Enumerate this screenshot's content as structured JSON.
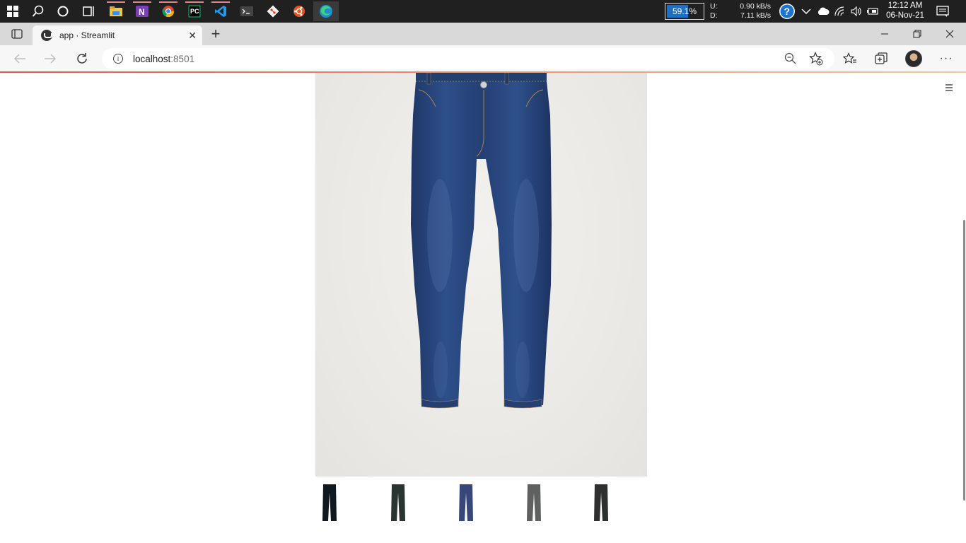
{
  "taskbar": {
    "battery_percent": "59.1%",
    "net_up_label": "U:",
    "net_down_label": "D:",
    "net_up_speed": "0.90 kB/s",
    "net_down_speed": "7.11 kB/s",
    "time": "12:12 AM",
    "date": "06-Nov-21",
    "icons": [
      "windows-start-icon",
      "search-icon",
      "cortana-icon",
      "task-view-icon",
      "file-explorer-icon",
      "onenote-icon",
      "chrome-icon",
      "pycharm-icon",
      "vscode-icon",
      "terminal-icon",
      "git-icon",
      "ubuntu-icon",
      "edge-icon"
    ]
  },
  "browser": {
    "tab_title": "app · Streamlit",
    "url_host": "localhost",
    "url_port": ":8501"
  },
  "app": {
    "main_image": "dark blue skinny jeans",
    "thumbnails": [
      {
        "description": "black slim jeans",
        "color": "#101820"
      },
      {
        "description": "dark green-grey trousers",
        "color": "#2a3430"
      },
      {
        "description": "indigo slim jeans",
        "color": "#37477a"
      },
      {
        "description": "grey denim jeans",
        "color": "#5d6260"
      },
      {
        "description": "charcoal trousers",
        "color": "#2c302e"
      }
    ]
  },
  "colors": {
    "taskbar_bg": "#202020",
    "tab_bar_bg": "#d9d9d9",
    "denim": "#2c4a80"
  }
}
